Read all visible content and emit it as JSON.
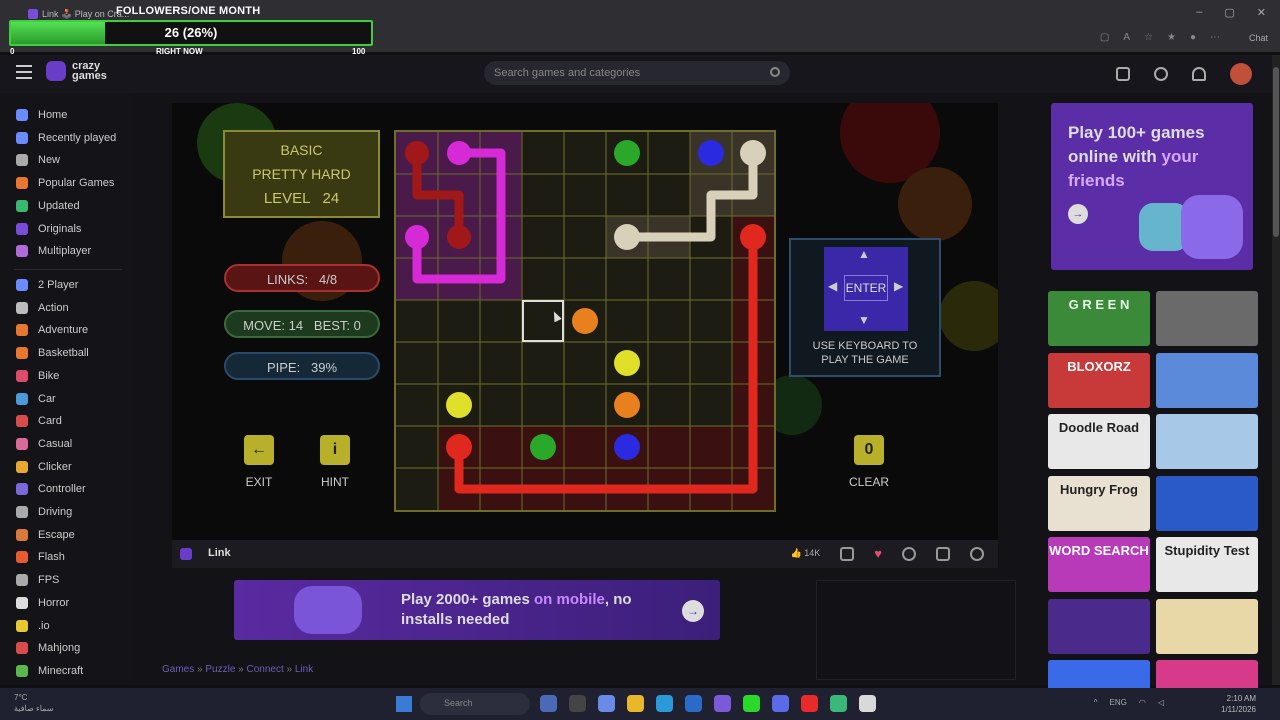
{
  "browser": {
    "tab_title": "Link 🕹️ Play on Cra...",
    "chat_label": "Chat"
  },
  "overlay": {
    "title": "FOLLOWERS/ONE MONTH",
    "value": "26 (26%)",
    "progress": 0.26,
    "min_label": "0",
    "now_label": "RIGHT NOW",
    "max_label": "100"
  },
  "header": {
    "logo_line1": "crazy",
    "logo_line2": "games",
    "search_placeholder": "Search games and categories",
    "notification_count": "1"
  },
  "sidebar": {
    "primary": [
      {
        "label": "Home",
        "icon": "home-icon",
        "color": "#6a8cff"
      },
      {
        "label": "Recently played",
        "icon": "clock-icon",
        "color": "#6a8cff"
      },
      {
        "label": "New",
        "icon": "sparkle-icon",
        "color": "#aaaaaa"
      },
      {
        "label": "Popular Games",
        "icon": "fire-icon",
        "color": "#e87830"
      },
      {
        "label": "Updated",
        "icon": "refresh-icon",
        "color": "#3ab870"
      },
      {
        "label": "Originals",
        "icon": "crazygames-icon",
        "color": "#7a4cd9"
      },
      {
        "label": "Multiplayer",
        "icon": "users-icon",
        "color": "#b06ad9"
      }
    ],
    "categories": [
      {
        "label": "2 Player",
        "icon": "two-player-icon",
        "color": "#6a8cff"
      },
      {
        "label": "Action",
        "icon": "sword-icon",
        "color": "#bbbbbb"
      },
      {
        "label": "Adventure",
        "icon": "compass-icon",
        "color": "#e87830"
      },
      {
        "label": "Basketball",
        "icon": "basketball-icon",
        "color": "#e8782e"
      },
      {
        "label": "Bike",
        "icon": "bike-icon",
        "color": "#d94c6a"
      },
      {
        "label": "Car",
        "icon": "car-icon",
        "color": "#4c9ad9"
      },
      {
        "label": "Card",
        "icon": "card-icon",
        "color": "#d94c4c"
      },
      {
        "label": "Casual",
        "icon": "casual-icon",
        "color": "#d96a9a"
      },
      {
        "label": "Clicker",
        "icon": "clicker-icon",
        "color": "#e8a830"
      },
      {
        "label": "Controller",
        "icon": "gamepad-icon",
        "color": "#7a6ad9"
      },
      {
        "label": "Driving",
        "icon": "steering-icon",
        "color": "#aaaaaa"
      },
      {
        "label": "Escape",
        "icon": "door-icon",
        "color": "#d97a3a"
      },
      {
        "label": "Flash",
        "icon": "flash-icon",
        "color": "#e85a30"
      },
      {
        "label": "FPS",
        "icon": "gun-icon",
        "color": "#aaaaaa"
      },
      {
        "label": "Horror",
        "icon": "ghost-icon",
        "color": "#dddddd"
      },
      {
        "label": ".io",
        "icon": "io-icon",
        "color": "#e8c830"
      },
      {
        "label": "Mahjong",
        "icon": "mahjong-icon",
        "color": "#d94c4c"
      },
      {
        "label": "Minecraft",
        "icon": "minecraft-icon",
        "color": "#5ab84c"
      }
    ]
  },
  "game": {
    "mode": "BASIC",
    "difficulty": "PRETTY HARD",
    "level": "LEVEL   24",
    "links": "LINKS:   4/8",
    "moves": "MOVE: 14   BEST: 0",
    "pipe": "PIPE:   39%",
    "exit_label": "EXIT",
    "hint_label": "HINT",
    "clear_label": "CLEAR",
    "clear_count": "0",
    "enter_label": "ENTER",
    "keyboard_hint_1": "USE KEYBOARD TO",
    "keyboard_hint_2": "PLAY THE GAME",
    "colors": {
      "magenta": "#d62ad6",
      "red": "#e0281e",
      "cream": "#d8d0b8",
      "green": "#2aa82a",
      "blue": "#2a2ae0",
      "orange": "#e8801e",
      "yellow": "#e0e02a"
    }
  },
  "gamebar": {
    "title": "Link",
    "likes": "14K"
  },
  "banner": {
    "text_prefix": "Play 2000+ games ",
    "text_accent": "on mobile",
    "text_suffix": ", no",
    "text_line2": "installs needed"
  },
  "breadcrumb": [
    "Games",
    "Puzzle",
    "Connect",
    "Link"
  ],
  "promo": {
    "line1": "Play 100+ games",
    "line2_a": "online with ",
    "line2_b": "your",
    "line3": "friends"
  },
  "thumbnails": [
    {
      "title": "G R E E N",
      "bg": "#3a8a3a",
      "fg": "#e8f8e8"
    },
    {
      "title": "",
      "bg": "#6a6a6a",
      "fg": "#ffffff"
    },
    {
      "title": "BLOXORZ",
      "bg": "#c83a3a",
      "fg": "#ffffff"
    },
    {
      "title": "",
      "bg": "#5a8ad9",
      "fg": "#ffffff"
    },
    {
      "title": "Doodle Road",
      "bg": "#e8e8e8",
      "fg": "#222222"
    },
    {
      "title": "",
      "bg": "#a8c8e8",
      "fg": "#3a6ab8"
    },
    {
      "title": "Hungry Frog",
      "bg": "#e8e0d0",
      "fg": "#222222"
    },
    {
      "title": "",
      "bg": "#2a5ac8",
      "fg": "#ffffff"
    },
    {
      "title": "WORD SEARCH",
      "bg": "#b83ab8",
      "fg": "#ffffff"
    },
    {
      "title": "Stupidity Test",
      "bg": "#e8e8e8",
      "fg": "#222222"
    },
    {
      "title": "",
      "bg": "#4a2a8a",
      "fg": "#ffffff"
    },
    {
      "title": "",
      "bg": "#e8d8a8",
      "fg": "#222222"
    },
    {
      "title": "",
      "bg": "#3a6ae8",
      "fg": "#ffffff"
    },
    {
      "title": "",
      "bg": "#d83a8a",
      "fg": "#ffffff"
    }
  ],
  "taskbar": {
    "weather_temp": "7°C",
    "weather_desc": "سماء صافية",
    "search_label": "Search",
    "lang": "ENG",
    "time": "2:10 AM",
    "date": "1/11/2026"
  }
}
